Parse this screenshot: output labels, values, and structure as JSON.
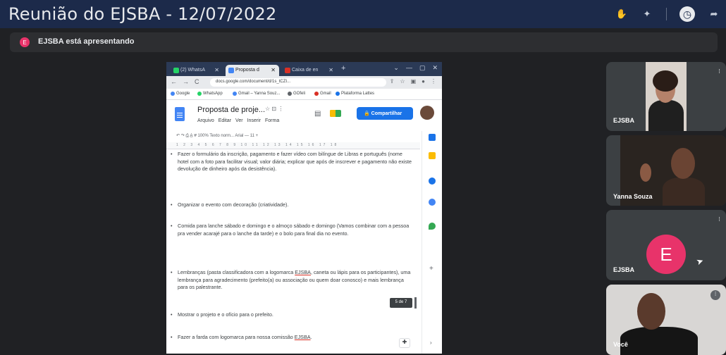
{
  "meeting": {
    "title": "Reunião do EJSBA - 12/07/2022",
    "presenting_avatar": "E",
    "presenting_text": "EJSBA está apresentando"
  },
  "browser": {
    "tabs": [
      {
        "label": "(2) WhatsA",
        "icon_color": "#25d366"
      },
      {
        "label": "Proposta d",
        "icon_color": "#4285f4"
      },
      {
        "label": "Caixa de en",
        "icon_color": "#d93025"
      }
    ],
    "new_tab": "+",
    "url": "docs.google.com/document/d/1s_tCZI...",
    "bookmarks": [
      "Google",
      "WhatsApp",
      "Gmail – Yanna Souz...",
      "GOfeli",
      "Gmail",
      "Plataforma Lattes"
    ]
  },
  "docs": {
    "title": "Proposta de proje...",
    "menu": [
      "Arquivo",
      "Editar",
      "Ver",
      "Inserir",
      "Forma"
    ],
    "share_label": "Compartilhar",
    "toolbar": "100%   Texto norm...   Arial   —   11   +",
    "ruler": "1 2 3 4 5 6 7 8 9 10 11 12 13 14 15 16 17 18",
    "bullets": [
      "Fazer o formulário da inscrição, pagamento e fazer vídeo com bilíngue de Libras e português (nome hotel com a foto para facilitar visual; valor diária; explicar que após de inscrever e pagamento não existe devolução de dinheiro após da desistência).",
      "Organizar o evento com decoração (criatividade).",
      "Comida para lanche sábado e domingo e o almoço sábado e domingo (Vamos combinar com a pessoa pra vender acarajé para o lanche da tarde) e o bolo para final dia no evento.",
      "Lembranças (pasta classificadora com a logomarca ",
      "Mostrar o projeto e o ofício para o prefeito.",
      "Fazer a farda com logomarca para nossa comissão "
    ],
    "bullet4_link": "EJSBA",
    "bullet4_rest": ", caneta ou lápis para os participantes), uma lembrança para agradecimento (prefeito(a) ou associação ou quem doar conosco) e mais lembrança para os palestrante.",
    "bullet6_link": "EJSBA",
    "bullet6_rest": ".",
    "page_indicator": "5 de 7"
  },
  "participants": [
    {
      "name": "EJSBA"
    },
    {
      "name": "Yanna Souza"
    },
    {
      "name": "EJSBA",
      "avatar_letter": "E"
    },
    {
      "name": "Você"
    }
  ],
  "colors": {
    "titlebar": "#1c2a4a",
    "avatar_pink": "#e8336a",
    "share_blue": "#1a73e8"
  }
}
